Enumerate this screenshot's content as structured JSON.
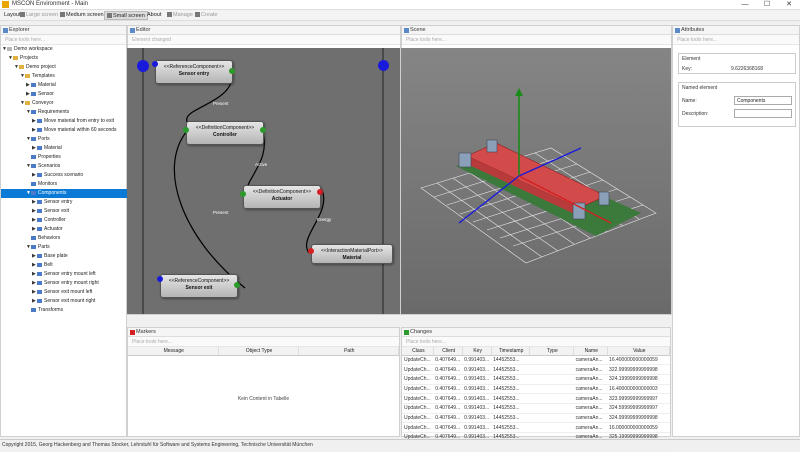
{
  "window": {
    "title": "MSCON Environment - Main",
    "minimize": "—",
    "maximize": "☐",
    "close": "✕",
    "icon": "app-icon"
  },
  "toolbar": {
    "layout_label": "Layout",
    "large_screen": "Large screen",
    "medium_screen": "Medium screen",
    "small_screen": "Small screen",
    "about": "About",
    "manage": "Manage",
    "create": "Create"
  },
  "explorer": {
    "title": "Explorer",
    "placeholder": "Place tools here...",
    "tree": [
      {
        "label": "Demo workspace",
        "level": 0,
        "arrow": "▼"
      },
      {
        "label": "Projects",
        "level": 1,
        "arrow": "▼"
      },
      {
        "label": "Demo project",
        "level": 2,
        "arrow": "▼"
      },
      {
        "label": "Templates",
        "level": 3,
        "arrow": "▼"
      },
      {
        "label": "Material",
        "level": 4,
        "arrow": "▶"
      },
      {
        "label": "Sensor",
        "level": 4,
        "arrow": "▶"
      },
      {
        "label": "Conveyor",
        "level": 3,
        "arrow": "▼"
      },
      {
        "label": "Requirements",
        "level": 4,
        "arrow": "▼"
      },
      {
        "label": "Move material from entry to exit",
        "level": 5,
        "arrow": "▶"
      },
      {
        "label": "Move material within 60 seconds",
        "level": 5,
        "arrow": "▶"
      },
      {
        "label": "Ports",
        "level": 4,
        "arrow": "▼"
      },
      {
        "label": "Material",
        "level": 5,
        "arrow": "▶"
      },
      {
        "label": "Properties",
        "level": 4,
        "arrow": ""
      },
      {
        "label": "Scenarios",
        "level": 4,
        "arrow": "▼"
      },
      {
        "label": "Success scenario",
        "level": 5,
        "arrow": "▶"
      },
      {
        "label": "Monitors",
        "level": 4,
        "arrow": ""
      },
      {
        "label": "Components",
        "level": 4,
        "arrow": "▼",
        "selected": true
      },
      {
        "label": "Sensor entry",
        "level": 5,
        "arrow": "▶"
      },
      {
        "label": "Sensor exit",
        "level": 5,
        "arrow": "▶"
      },
      {
        "label": "Controller",
        "level": 5,
        "arrow": "▶"
      },
      {
        "label": "Actuator",
        "level": 5,
        "arrow": "▶"
      },
      {
        "label": "Behaviors",
        "level": 4,
        "arrow": ""
      },
      {
        "label": "Parts",
        "level": 4,
        "arrow": "▼"
      },
      {
        "label": "Base plate",
        "level": 5,
        "arrow": "▶"
      },
      {
        "label": "Belt",
        "level": 5,
        "arrow": "▶"
      },
      {
        "label": "Sensor entry mount left",
        "level": 5,
        "arrow": "▶"
      },
      {
        "label": "Sensor entry mount right",
        "level": 5,
        "arrow": "▶"
      },
      {
        "label": "Sensor exit mount left",
        "level": 5,
        "arrow": "▶"
      },
      {
        "label": "Sensor exit mount right",
        "level": 5,
        "arrow": "▶"
      },
      {
        "label": "Transforms",
        "level": 4,
        "arrow": ""
      }
    ]
  },
  "editor": {
    "title": "Editor",
    "placeholder": "Element changed",
    "nodes": [
      {
        "stereotype": "<<ReferenceComponent>>",
        "name": "Sensor entry"
      },
      {
        "stereotype": "<<DefinitionComponent>>",
        "name": "Controller"
      },
      {
        "stereotype": "<<DefinitionComponent>>",
        "name": "Actuator"
      },
      {
        "stereotype": "<<InteractionMaterialPort>>",
        "name": "Material"
      },
      {
        "stereotype": "<<ReferenceComponent>>",
        "name": "Sensor exit"
      }
    ],
    "edges": [
      "Present",
      "Active",
      "Present",
      "Energy"
    ]
  },
  "scene": {
    "title": "Scene",
    "placeholder": "Place tools here..."
  },
  "markers": {
    "title": "Markers",
    "placeholder": "Place tools here...",
    "columns": [
      "Message",
      "Object Type",
      "Path"
    ],
    "empty_text": "Kein Content in Tabelle"
  },
  "changes": {
    "title": "Changes",
    "placeholder": "Place tools here...",
    "columns": [
      "Class",
      "Client",
      "Key",
      "Timestamp",
      "Type",
      "Name",
      "Value"
    ],
    "rows": [
      [
        "UpdateCh...",
        "0.407649...",
        "0.991403...",
        "14452553...",
        "",
        "cameraAn...",
        "16.400000000000059"
      ],
      [
        "UpdateCh...",
        "0.407649...",
        "0.991403...",
        "14452553...",
        "",
        "cameraAn...",
        "322.99999999999998"
      ],
      [
        "UpdateCh...",
        "0.407649...",
        "0.991403...",
        "14452553...",
        "",
        "cameraAn...",
        "324.19999999999998"
      ],
      [
        "UpdateCh...",
        "0.407649...",
        "0.991403...",
        "14452553...",
        "",
        "cameraAn...",
        "16.400000000000003"
      ],
      [
        "UpdateCh...",
        "0.407649...",
        "0.991403...",
        "14452553...",
        "",
        "cameraAn...",
        "323.99999999999997"
      ],
      [
        "UpdateCh...",
        "0.407649...",
        "0.991403...",
        "14452553...",
        "",
        "cameraAn...",
        "324.59999999999997"
      ],
      [
        "UpdateCh...",
        "0.407649...",
        "0.991403...",
        "14452553...",
        "",
        "cameraAn...",
        "324.99999999999998"
      ],
      [
        "UpdateCh...",
        "0.407649...",
        "0.991403...",
        "14452553...",
        "",
        "cameraAn...",
        "16.000000000000059"
      ],
      [
        "UpdateCh...",
        "0.407649...",
        "0.991403...",
        "14452553...",
        "",
        "cameraAn...",
        "325.19999999999998"
      ],
      [
        "UpdateCh...",
        "0.407649...",
        "0.991403...",
        "14452553...",
        "",
        "cameraAn...",
        "16.800000000000059"
      ]
    ]
  },
  "attributes": {
    "title": "Attributes",
    "placeholder": "Place tools here...",
    "element_group": "Element",
    "key_label": "Key:",
    "key_value": "9.6226368168",
    "named_group": "Named element",
    "name_label": "Name:",
    "name_value": "Components",
    "description_label": "Description:",
    "description_value": ""
  },
  "status": {
    "text": "Copyright 2015, Georg Hackenberg and Thomas Stocker, Lehrstuhl für Software and Systems Engineering, Technische Universität München"
  },
  "colors": {
    "accent": "#0a7ad6",
    "port_blue": "#1a1adc",
    "port_green": "#2a9a2a",
    "port_red": "#d42020",
    "belt_red": "#d24a4a",
    "base_green": "#3c7a3c"
  }
}
